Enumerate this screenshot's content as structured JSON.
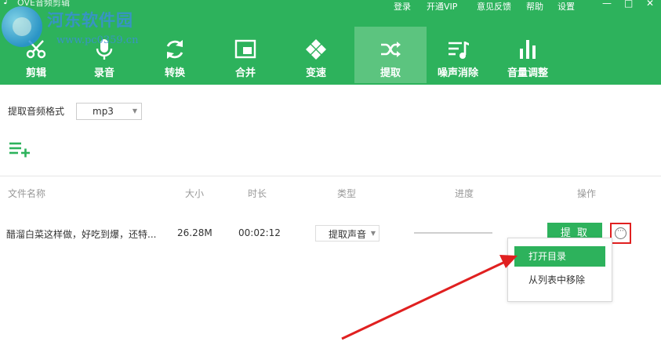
{
  "app": {
    "title": "OVE音频剪辑",
    "top_links": [
      "登录",
      "开通VIP",
      "意见反馈",
      "帮助",
      "设置"
    ],
    "window_controls": {
      "minimize": "—",
      "maximize": "□",
      "close": "✕"
    }
  },
  "watermark": {
    "text": "河东软件园",
    "url": "www.pc0359.cn"
  },
  "tabs": [
    {
      "label": "剪辑",
      "icon": "scissors-icon",
      "active": false
    },
    {
      "label": "录音",
      "icon": "microphone-icon",
      "active": false
    },
    {
      "label": "转换",
      "icon": "refresh-icon",
      "active": false
    },
    {
      "label": "合并",
      "icon": "merge-icon",
      "active": false
    },
    {
      "label": "变速",
      "icon": "gamepad-icon",
      "active": false
    },
    {
      "label": "提取",
      "icon": "shuffle-icon",
      "active": true
    },
    {
      "label": "噪声消除",
      "icon": "music-list-icon",
      "active": false
    },
    {
      "label": "音量调整",
      "icon": "bar-chart-icon",
      "active": false
    }
  ],
  "settings": {
    "format_label": "提取音频格式",
    "format_value": "mp3"
  },
  "table": {
    "headers": {
      "name": "文件名称",
      "size": "大小",
      "duration": "时长",
      "type": "类型",
      "progress": "进度",
      "action": "操作"
    },
    "rows": [
      {
        "name": "醋溜白菜这样做，好吃到爆，还特...",
        "size": "26.28M",
        "duration": "00:02:12",
        "type": "提取声音",
        "progress": 0,
        "action_label": "提 取"
      }
    ]
  },
  "context_menu": {
    "items": [
      {
        "label": "打开目录",
        "active": true
      },
      {
        "label": "从列表中移除",
        "active": false
      }
    ]
  },
  "colors": {
    "primary": "#2db25c",
    "active_tab": "#5cc47f",
    "annotation": "#e02020"
  }
}
